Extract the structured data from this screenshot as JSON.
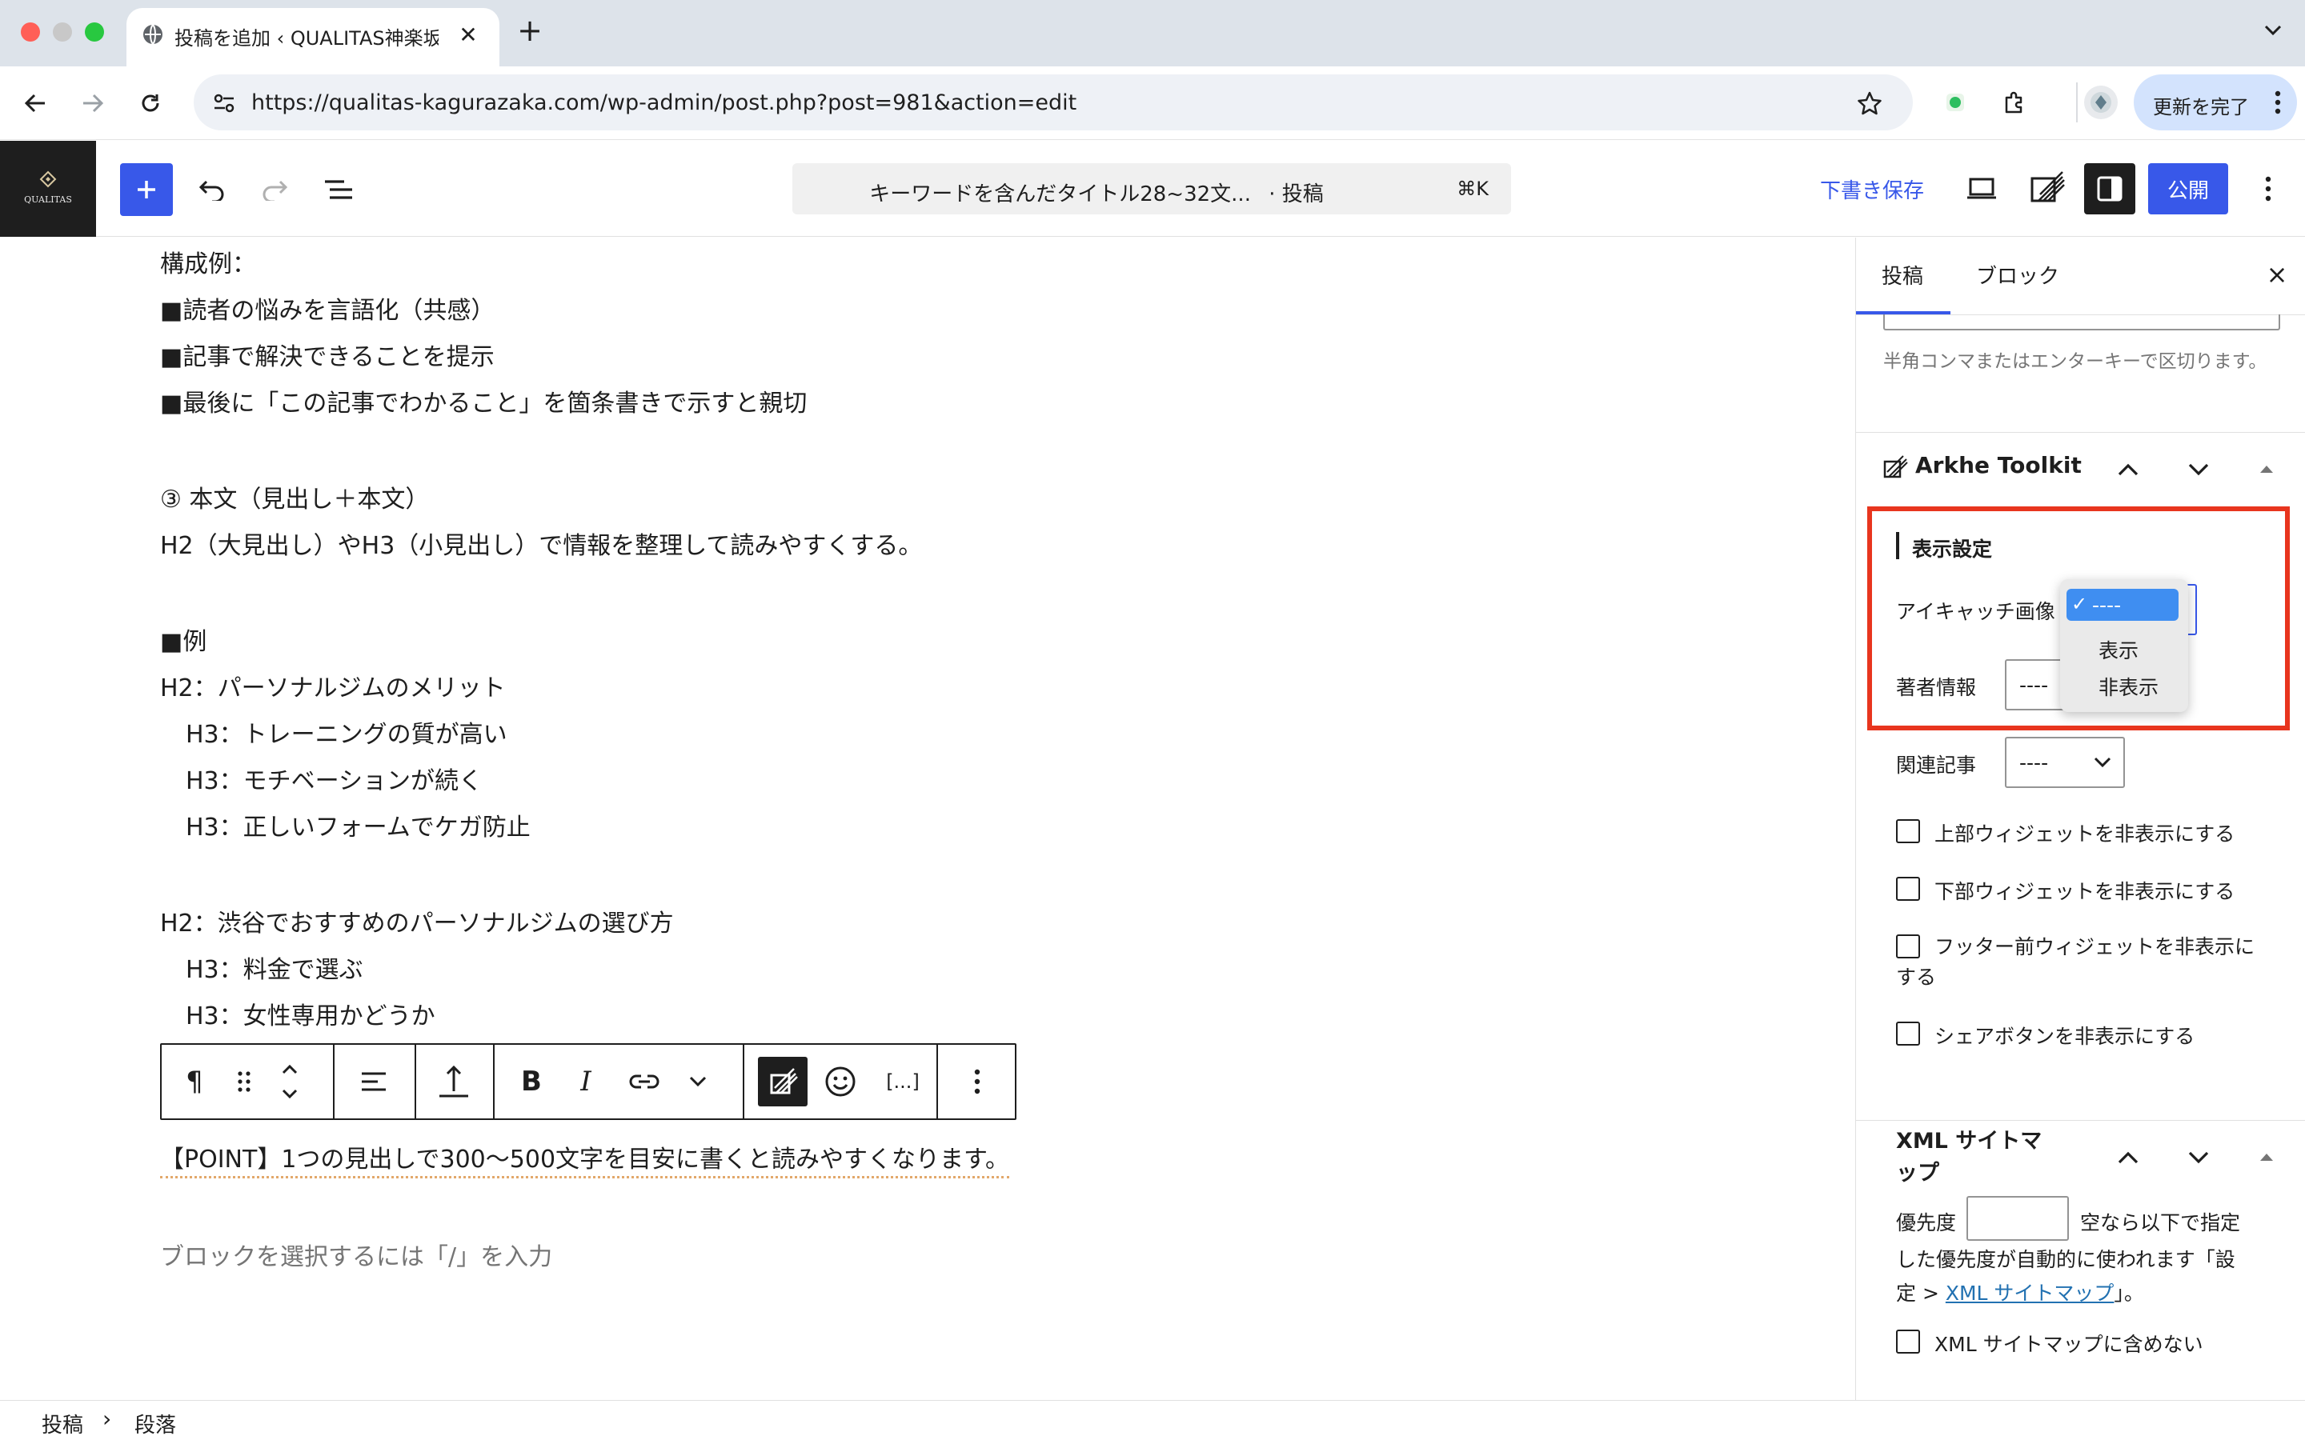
{
  "browser": {
    "tab_title": "投稿を追加 ‹ QUALITAS神楽坂店",
    "new_tab": "+",
    "url": "https://qualitas-kagurazaka.com/wp-admin/post.php?post=981&action=edit",
    "update_label": "更新を完了"
  },
  "wp_header": {
    "logo_text": "QUALITAS",
    "command_title": "キーワードを含んだタイトル28~32文...",
    "command_suffix": "· 投稿",
    "command_kbd": "⌘K",
    "save_draft": "下書き保存",
    "publish": "公開"
  },
  "content": {
    "lines": [
      "構成例：",
      "■読者の悩みを言語化（共感）",
      "■記事で解決できることを提示",
      "■最後に「この記事でわかること」を箇条書きで示すと親切",
      "③ 本文（見出し＋本文）",
      "H2（大見出し）やH3（小見出し）で情報を整理して読みやすくする。",
      "■例",
      "H2：パーソナルジムのメリット",
      "H3：トレーニングの質が高い",
      "H3：モチベーションが続く",
      "H3：正しいフォームでケガ防止",
      "H2：渋谷でおすすめのパーソナルジムの選び方",
      "H3：料金で選ぶ",
      "H3：女性専用かどうか"
    ],
    "point": "【POINT】1つの見出しで300〜500文字を目安に書くと読みやすくなります。",
    "placeholder": "ブロックを選択するには「/」を入力",
    "toolbar": {
      "paragraph": "¶",
      "bold": "B",
      "italic": "I",
      "shortcode": "[...]"
    }
  },
  "footer": {
    "crumb_post": "投稿",
    "separator": "›",
    "crumb_block": "段落"
  },
  "sidebar": {
    "tab_post": "投稿",
    "tab_block": "ブロック",
    "close": "×",
    "tag_hint": "半角コンマまたはエンターキーで区切ります。",
    "arkhe": {
      "title": "Arkhe Toolkit",
      "section_title": "表示設定",
      "eyecatch_label": "アイキャッチ画像",
      "author_label": "著者情報",
      "author_value": "----",
      "related_label": "関連記事",
      "related_value": "----",
      "dropdown_options": [
        "----",
        "表示",
        "非表示"
      ],
      "checkboxes": [
        "上部ウィジェットを非表示にする",
        "下部ウィジェットを非表示にする",
        "フッター前ウィジェットを非表示にする",
        "シェアボタンを非表示にする"
      ]
    },
    "xml": {
      "title": "XML サイトマップ",
      "priority_label": "優先度",
      "priority_hint_1": "空なら以下で指定",
      "priority_hint_2": "した優先度が自動的に使われます「設",
      "priority_hint_3_pre": "定 > ",
      "priority_hint_link": "XML サイトマップ",
      "priority_hint_3_post": "」。",
      "exclude_label": "XML サイトマップに含めない"
    }
  },
  "colors": {
    "wp_blue": "#3858e9",
    "highlight_red": "#e8351e",
    "dropdown_selected": "#3f8ef1"
  }
}
